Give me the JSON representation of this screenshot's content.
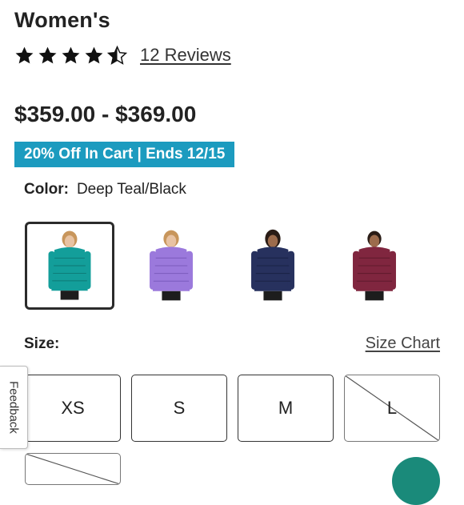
{
  "product": {
    "title": "Women's",
    "rating": 4.5,
    "rating_max": 5,
    "reviews_label": "12 Reviews",
    "price": "$359.00 - $369.00",
    "promo": "20% Off In Cart | Ends 12/15",
    "colors": {
      "star": "#111111",
      "promo_bg": "#1c9bbf"
    }
  },
  "color": {
    "label": "Color:",
    "value": "Deep Teal/Black",
    "options": [
      {
        "name": "Deep Teal/Black",
        "jacket": "#139e9a",
        "selected": true
      },
      {
        "name": "Purple",
        "jacket": "#9b79dc",
        "selected": false
      },
      {
        "name": "Navy",
        "jacket": "#27315e",
        "selected": false
      },
      {
        "name": "Burgundy",
        "jacket": "#80263f",
        "selected": false
      }
    ]
  },
  "size": {
    "label": "Size:",
    "chart_link": "Size Chart",
    "options": [
      {
        "label": "XS",
        "available": true
      },
      {
        "label": "S",
        "available": true
      },
      {
        "label": "M",
        "available": true
      },
      {
        "label": "L",
        "available": false
      },
      {
        "label": "",
        "available": false
      }
    ]
  },
  "feedback_tab": "Feedback"
}
